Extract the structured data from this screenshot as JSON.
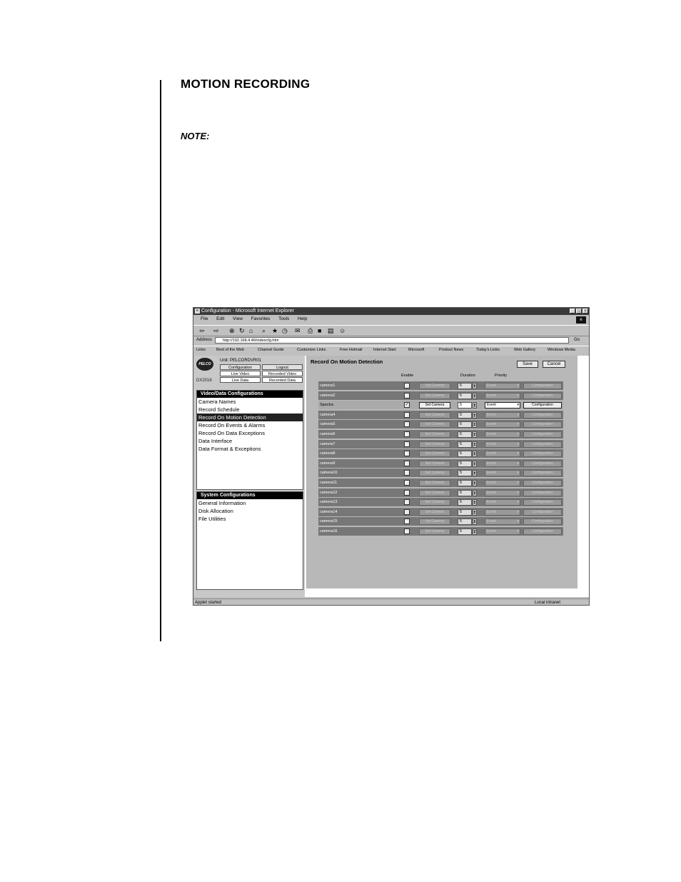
{
  "doc": {
    "heading": "MOTION RECORDING",
    "note_label": "NOTE:"
  },
  "window": {
    "title": "Configuration - Microsoft Internet Explorer",
    "menu": [
      "File",
      "Edit",
      "View",
      "Favorites",
      "Tools",
      "Help"
    ],
    "address_label": "Address",
    "address_value": "http://192.168.4.46/indexcfg.htm",
    "go_label": "Go",
    "links_label": "Links",
    "links": [
      "Best of the Web",
      "Channel Guide",
      "Customize Links",
      "Free Hotmail",
      "Internet Start",
      "Microsoft",
      "Product News",
      "Today's Links",
      "Web Gallery",
      "Windows Media"
    ],
    "status_left": "Applet started",
    "status_right": "Local intranet"
  },
  "app": {
    "logo_text": "PELCO",
    "model": "DX2016",
    "unit_label": "Unit: PELCORDVR01",
    "nav": [
      "Configuration",
      "Logout",
      "Live Video",
      "Recorded Video",
      "Live Data",
      "Recorded Data"
    ],
    "video_panel": {
      "header": "Video/Data Configurations",
      "items": [
        "Camera Names",
        "Record Schedule",
        "Record On Motion Detection",
        "Record On Events & Alarms",
        "Record On Data Exceptions",
        "Data Interface",
        "Data Format & Exceptions"
      ]
    },
    "system_panel": {
      "header": "System Configurations",
      "items": [
        "General Information",
        "Disk Allocation",
        "File Utilities"
      ]
    },
    "main": {
      "title": "Record On Motion Detection",
      "save_label": "Save",
      "cancel_label": "Cancel",
      "col_enable": "Enable",
      "col_duration": "Duration",
      "col_priority": "Priority",
      "set_camera_label": "Set Camera",
      "configuration_label": "Configuration",
      "rows": [
        {
          "name": "camera1",
          "enabled": false,
          "duration": "5",
          "priority": "Event"
        },
        {
          "name": "camera2",
          "enabled": false,
          "duration": "5",
          "priority": "Event"
        },
        {
          "name": "Spectra",
          "enabled": true,
          "duration": "5",
          "priority": "Event"
        },
        {
          "name": "camera4",
          "enabled": false,
          "duration": "5",
          "priority": "Event"
        },
        {
          "name": "camera5",
          "enabled": false,
          "duration": "5",
          "priority": "Event"
        },
        {
          "name": "camera6",
          "enabled": false,
          "duration": "5",
          "priority": "Event"
        },
        {
          "name": "camera7",
          "enabled": false,
          "duration": "5",
          "priority": "Event"
        },
        {
          "name": "camera8",
          "enabled": false,
          "duration": "5",
          "priority": "Event"
        },
        {
          "name": "camera9",
          "enabled": false,
          "duration": "5",
          "priority": "Event"
        },
        {
          "name": "camera10",
          "enabled": false,
          "duration": "5",
          "priority": "Event"
        },
        {
          "name": "camera11",
          "enabled": false,
          "duration": "5",
          "priority": "Event"
        },
        {
          "name": "camera12",
          "enabled": false,
          "duration": "5",
          "priority": "Event"
        },
        {
          "name": "camera13",
          "enabled": false,
          "duration": "5",
          "priority": "Event"
        },
        {
          "name": "camera14",
          "enabled": false,
          "duration": "5",
          "priority": "Event"
        },
        {
          "name": "camera15",
          "enabled": false,
          "duration": "5",
          "priority": "Event"
        },
        {
          "name": "camera16",
          "enabled": false,
          "duration": "5",
          "priority": "Event"
        }
      ]
    }
  }
}
